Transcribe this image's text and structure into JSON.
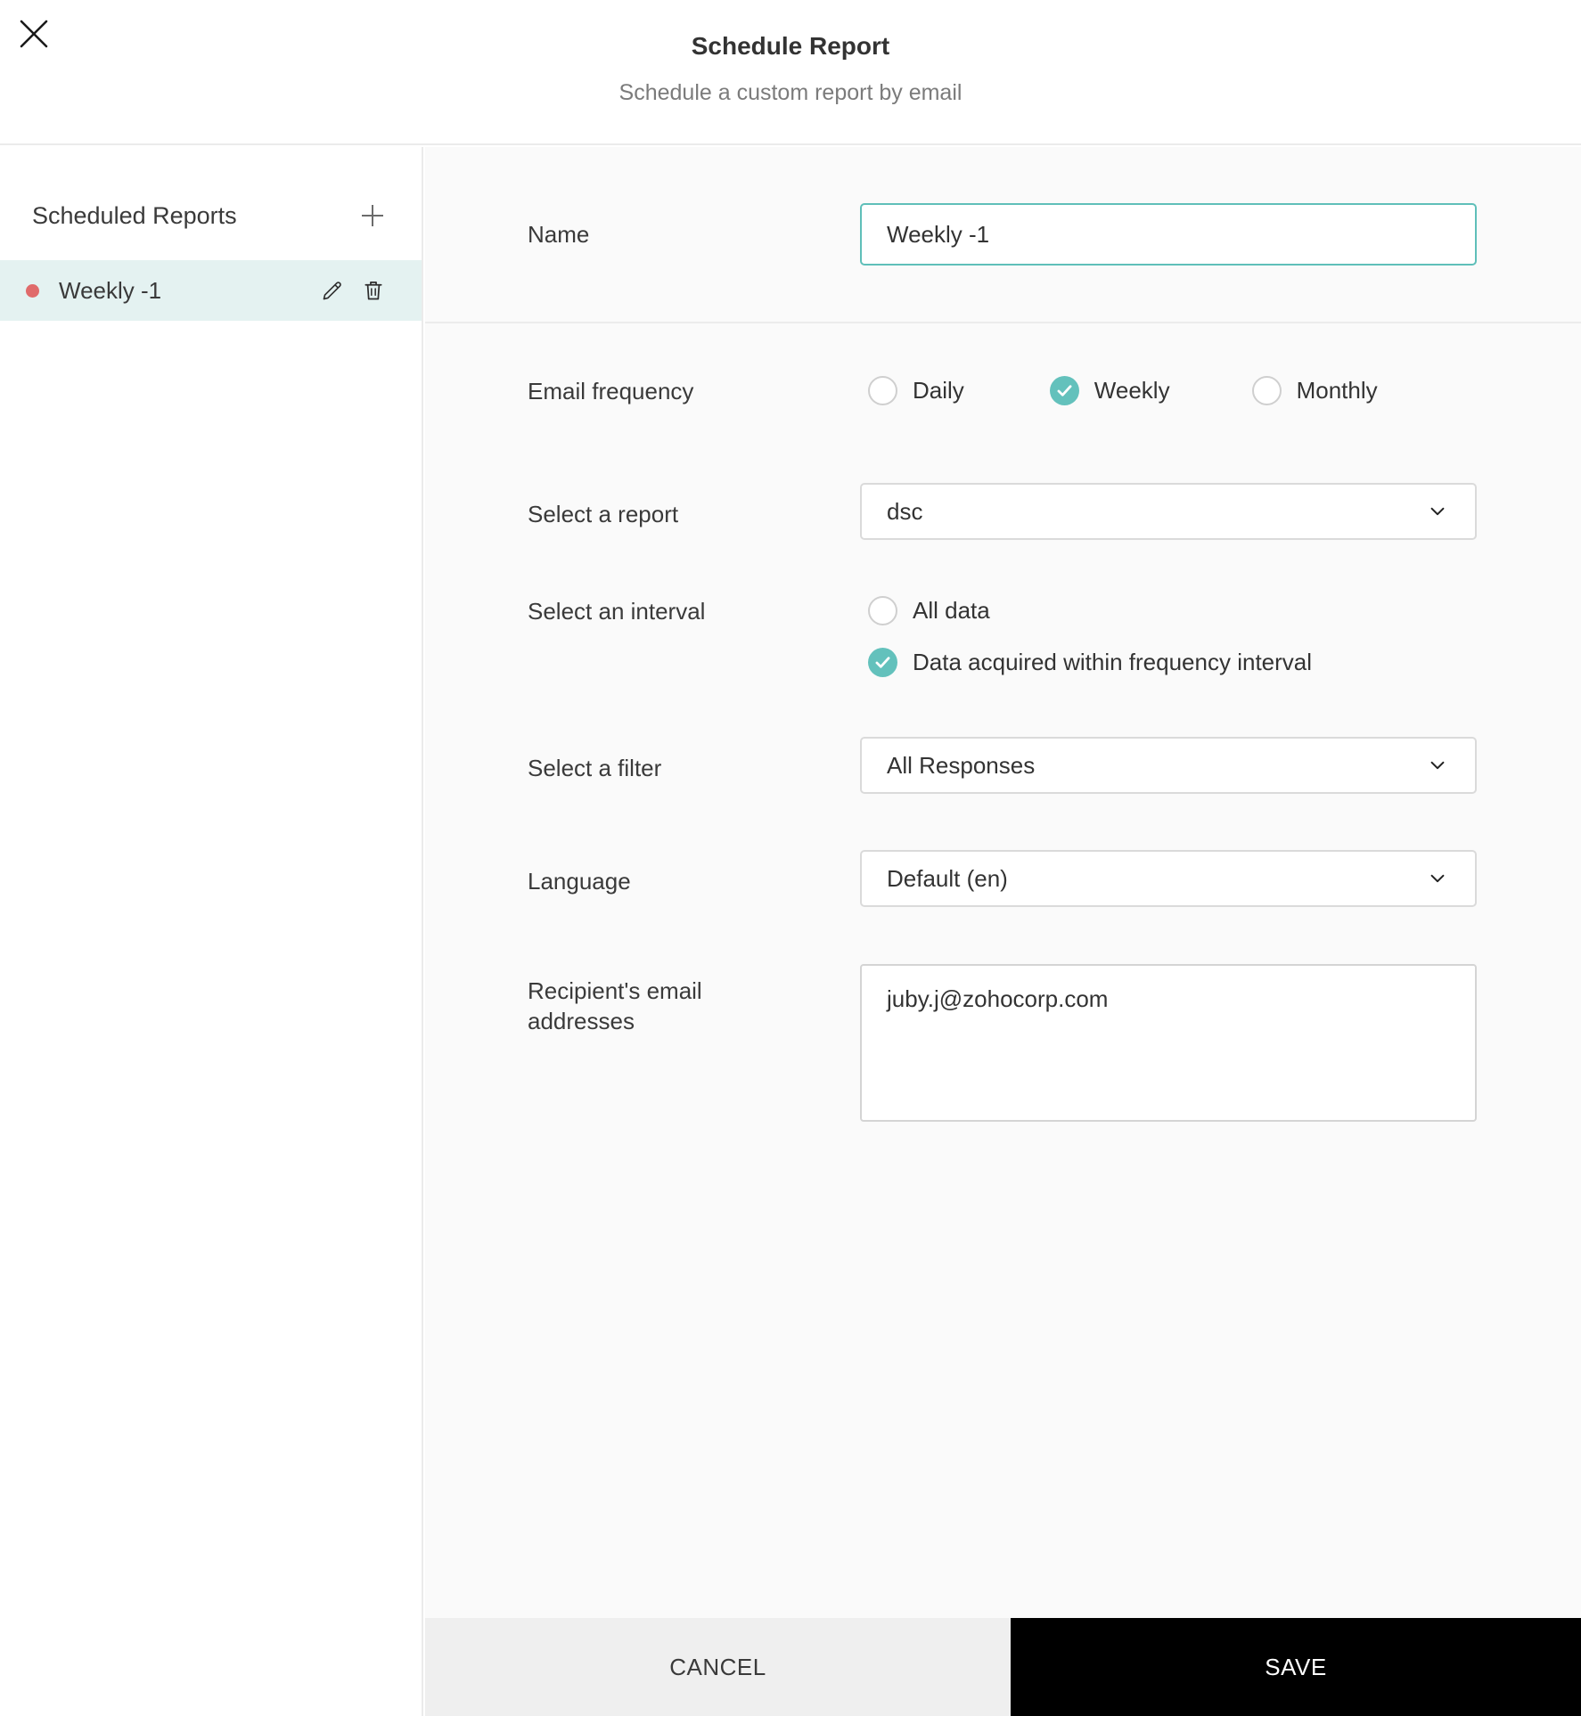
{
  "header": {
    "title": "Schedule Report",
    "subtitle": "Schedule a custom report by email"
  },
  "sidebar": {
    "title": "Scheduled Reports",
    "add_icon": "plus-icon",
    "items": [
      {
        "label": "Weekly -1",
        "selected": true,
        "status_dot_color": "#e06b6b",
        "actions": [
          "edit-icon",
          "delete-icon"
        ]
      }
    ]
  },
  "form": {
    "name": {
      "label": "Name",
      "value": "Weekly -1"
    },
    "email_frequency": {
      "label": "Email frequency",
      "options": [
        {
          "label": "Daily",
          "selected": false
        },
        {
          "label": "Weekly",
          "selected": true
        },
        {
          "label": "Monthly",
          "selected": false
        }
      ]
    },
    "report": {
      "label": "Select a report",
      "value": "dsc"
    },
    "interval": {
      "label": "Select an interval",
      "options": [
        {
          "label": "All data",
          "selected": false
        },
        {
          "label": "Data acquired within frequency interval",
          "selected": true
        }
      ]
    },
    "filter": {
      "label": "Select a filter",
      "value": "All Responses"
    },
    "language": {
      "label": "Language",
      "value": "Default (en)"
    },
    "recipients": {
      "label": "Recipient's email addresses",
      "value": "juby.j@zohocorp.com"
    }
  },
  "footer": {
    "cancel_label": "CANCEL",
    "save_label": "SAVE"
  },
  "colors": {
    "accent_teal": "#63c1bc",
    "name_input_border": "#5fbfb9",
    "selected_item_bg": "#e4f2f1",
    "status_dot": "#e06b6b",
    "main_bg": "#fafafa",
    "cancel_bg": "#efefef",
    "save_bg": "#000000"
  }
}
